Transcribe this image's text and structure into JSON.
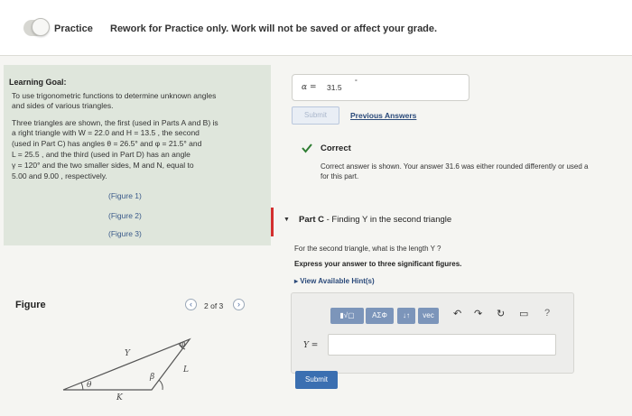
{
  "header": {
    "toggle_label": "Practice",
    "message": "Rework for Practice only. Work will not be saved or affect your grade."
  },
  "learning_goal": {
    "title": "Learning Goal:",
    "goal_line1": "To use trigonometric functions to determine unknown angles",
    "goal_line2": "and sides of various triangles.",
    "desc_lines": [
      "Three triangles are shown, the first (used in Parts A and B) is",
      "a right triangle with W = 22.0 and H = 13.5 , the second",
      "(used in Part C) has angles θ = 26.5° and φ = 21.5° and",
      "L = 25.5 , and the third (used in Part D) has an angle",
      "γ = 120° and the two smaller sides, M and N, equal to",
      "5.00 and 9.00 , respectively."
    ],
    "figure_links": [
      "(Figure 1)",
      "(Figure 2)",
      "(Figure 3)"
    ]
  },
  "figure": {
    "title": "Figure",
    "pager_text": "2 of 3",
    "prev_symbol": "‹",
    "next_symbol": "›",
    "labels": {
      "theta": "θ",
      "phi": "φ",
      "y": "Y",
      "l": "L",
      "beta": "β",
      "k": "K"
    }
  },
  "previous_part": {
    "alpha_symbol": "α =",
    "answer_value": "31.5",
    "degree_symbol": "°",
    "submit_label": "Submit",
    "previous_answers_label": "Previous Answers",
    "status_title": "Correct",
    "status_message_line1": "Correct answer is shown. Your answer 31.6 was either rounded differently or used a",
    "status_message_line2": "for this part."
  },
  "part_c": {
    "part_label": "Part C",
    "part_title": " - Finding Y in the second triangle",
    "question": "For the second triangle, what is the length Y ?",
    "instruction": "Express your answer to three significant figures.",
    "hints_label": "View Available Hint(s)",
    "toolbar": {
      "templates_label": "▮√▢",
      "greek_label": "ΑΣΦ",
      "sort_label": "↓↑",
      "vec_label": "vec",
      "undo_icon": "↶",
      "redo_icon": "↷",
      "reset_icon": "↻",
      "keyboard_icon": "▭",
      "help_icon": "?"
    },
    "y_label": "Y =",
    "submit_label": "Submit"
  },
  "colors": {
    "accent": "#3b6fb1",
    "correct_green": "#2e7d32",
    "part_red": "#d32f2f",
    "goal_bg": "#dfe6dc"
  }
}
